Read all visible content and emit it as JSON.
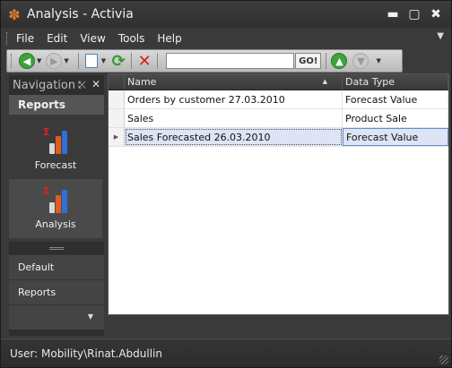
{
  "window": {
    "title": "Analysis - Activia",
    "controls": [
      "minimize-icon",
      "maximize-icon",
      "close-icon"
    ]
  },
  "menu": {
    "items": [
      "File",
      "Edit",
      "View",
      "Tools",
      "Help"
    ]
  },
  "toolbar": {
    "search_value": "",
    "go_label": "GO!",
    "icons": [
      "back-icon",
      "forward-icon",
      "new-document-icon",
      "refresh-icon",
      "stop-icon",
      "upload-icon",
      "download-icon"
    ]
  },
  "navigation": {
    "header": "Navigation",
    "group_title": "Reports",
    "links": [
      {
        "label": "Forecast",
        "icon": "bar-chart-icon",
        "active": false
      },
      {
        "label": "Analysis",
        "icon": "bar-chart-icon",
        "active": true
      }
    ],
    "items": [
      "Default",
      "Reports"
    ]
  },
  "grid": {
    "columns": [
      "Name",
      "Data Type"
    ],
    "sort": "ascending by Name",
    "rows": [
      {
        "name": "Orders by customer 27.03.2010",
        "type": "Forecast Value",
        "selected": false
      },
      {
        "name": "Sales",
        "type": "Product Sale",
        "selected": false
      },
      {
        "name": "Sales Forecasted 26.03.2010",
        "type": "Forecast Value",
        "selected": true
      }
    ]
  },
  "status": {
    "user": "User: Mobility\\Rinat.Abdullin"
  },
  "colors": {
    "app_icon": "#e07a2c",
    "selection": "#dde4f5",
    "back_green": "#3da33d",
    "stop_red": "#d42020"
  }
}
